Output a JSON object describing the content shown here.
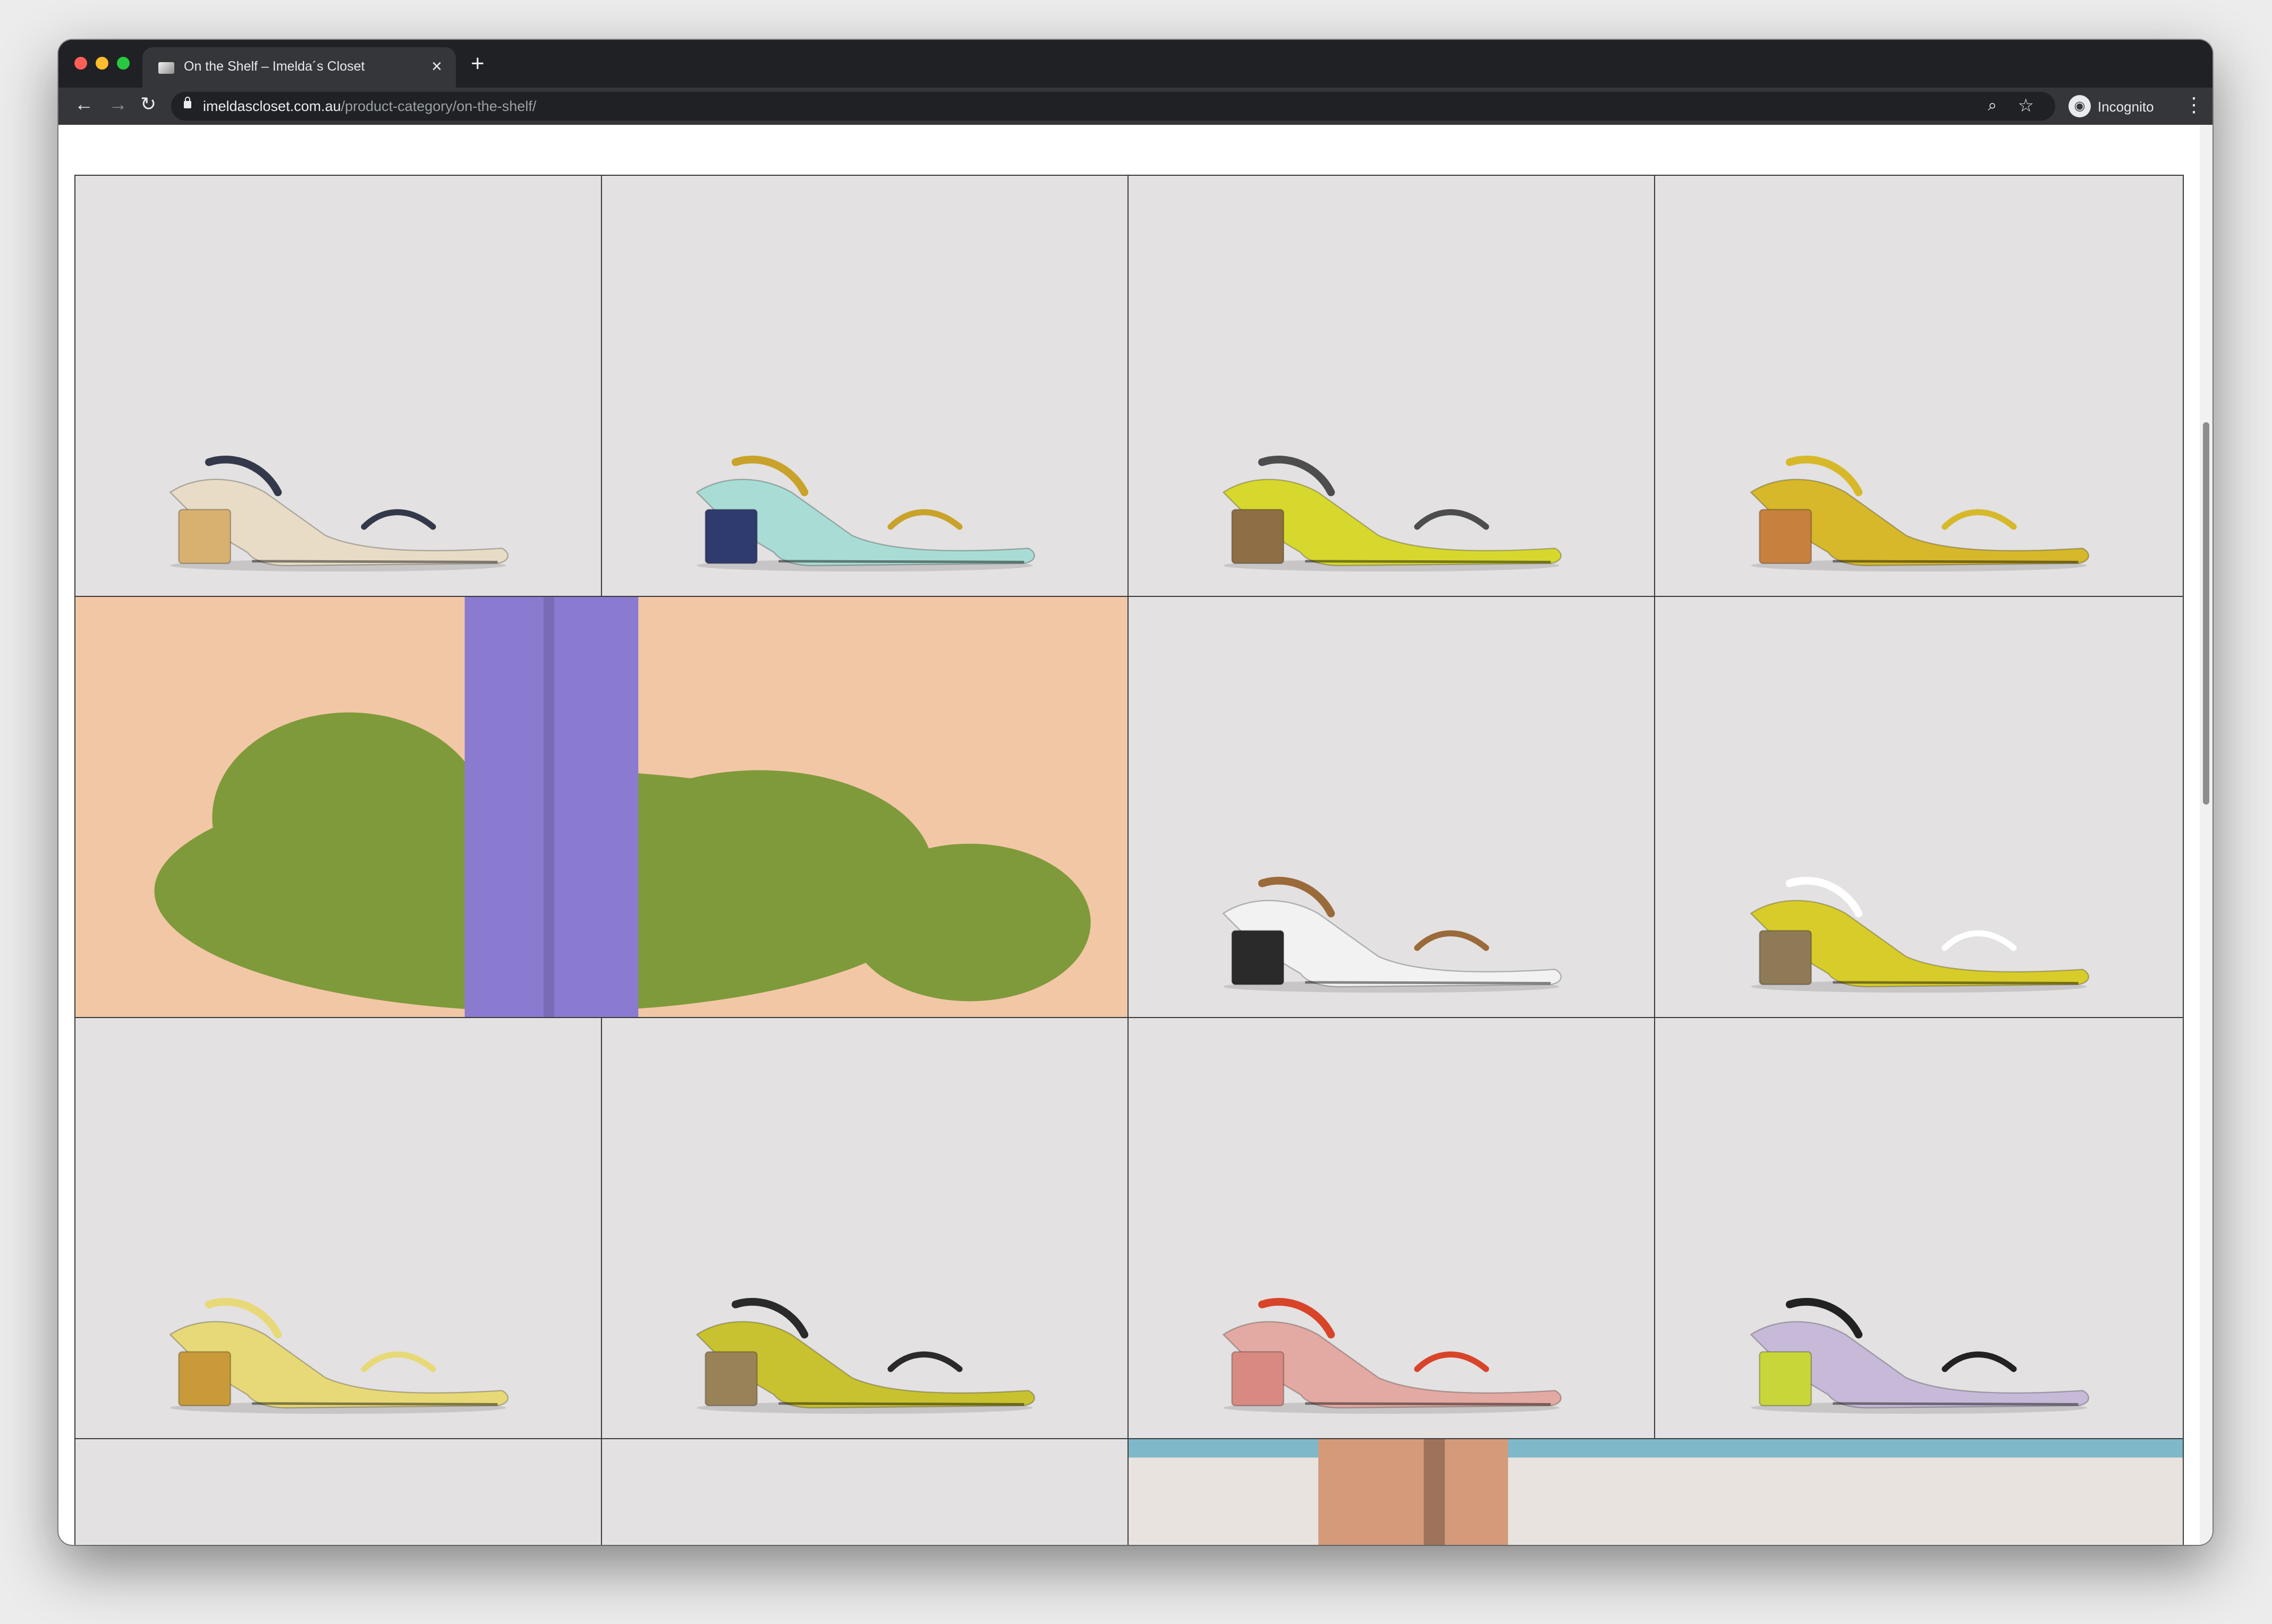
{
  "browser": {
    "tab_title": "On the Shelf – Imelda´s Closet",
    "tab_close": "×",
    "new_tab": "+",
    "url_host": "imeldascloset.com.au",
    "url_path": "/product-category/on-the-shelf/",
    "profile_label": "Incognito",
    "icons": {
      "back": "←",
      "forward": "→",
      "reload": "↻",
      "zoom": "⌕",
      "star": "☆",
      "menu": "⋮",
      "incognito": "◉"
    }
  },
  "products": [
    {
      "id": "p1",
      "colors": [
        "#e8dcc6",
        "#d8b070",
        "#33384a"
      ]
    },
    {
      "id": "p2",
      "colors": [
        "#a9dcd4",
        "#2f3b6e",
        "#c8a22a"
      ]
    },
    {
      "id": "p3",
      "colors": [
        "#d7d82e",
        "#8e6e44",
        "#4d4d4d"
      ]
    },
    {
      "id": "p4",
      "colors": [
        "#d6b82a",
        "#c8803e",
        "#d6b82a"
      ]
    },
    {
      "id": "p5",
      "colors": [
        "#f2f2f2",
        "#2a2a2a",
        "#9a6a3a"
      ]
    },
    {
      "id": "p6",
      "colors": [
        "#d8cc2a",
        "#8e7a56",
        "#ffffff"
      ]
    },
    {
      "id": "p7",
      "colors": [
        "#e8d978",
        "#c89a3a",
        "#e8d978"
      ]
    },
    {
      "id": "p8",
      "colors": [
        "#c8c230",
        "#9a8258",
        "#2a2a2a"
      ]
    },
    {
      "id": "p9",
      "colors": [
        "#e2aaa2",
        "#d88a82",
        "#d8442a"
      ]
    },
    {
      "id": "p10",
      "colors": [
        "#c6bad8",
        "#c8d63a",
        "#222222"
      ]
    },
    {
      "id": "p11",
      "colors": [
        "#e3e1e1",
        "#e3e1e1",
        "#e3e1e1"
      ]
    },
    {
      "id": "p12",
      "colors": [
        "#e3e1e1",
        "#e3e1e1",
        "#e3e1e1"
      ]
    }
  ],
  "banners": [
    {
      "id": "banner-desert",
      "colors": [
        "#f2c7a6",
        "#7f9a3a",
        "#8a7ad0"
      ]
    },
    {
      "id": "banner-saltflat",
      "colors": [
        "#7fb8c9",
        "#e9e3df",
        "#d49a7a"
      ]
    }
  ]
}
